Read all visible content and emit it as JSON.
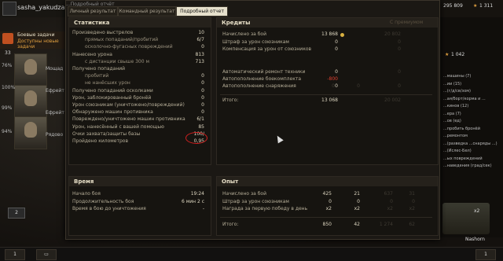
{
  "garage": {
    "username": "sasha_yakudza",
    "tasks_title": "Боевые задачи",
    "tasks_sub": "Доступны новые задачи",
    "crew_percents": [
      "100%",
      "99%",
      "94%"
    ],
    "left_badge": "33",
    "left_percent": "76%",
    "crew_names": [
      "Мощад",
      "Ефрейт",
      "Ефрейт",
      "Рядово"
    ],
    "gold": "295 809",
    "credits": "1 311",
    "right_value": "1 042",
    "tank_name": "Nashorn",
    "tank_level": "x2",
    "right_stats": [
      "...машины (7)",
      "...ии (15)",
      "...(г/д/св/зом)",
      "...ая/борт/корма и ...",
      "...кинов (12)",
      "...ера (7)",
      "...ов (ед)",
      "...пробить бронёй",
      "...ремонтом",
      "...(разведка ...снаряды ...)",
      "...(Ислес-Бел)",
      "...ых повреждений",
      "...наведения (град/сек)"
    ],
    "bottom_left": "1",
    "bottom_right": "1",
    "lock_count": "2"
  },
  "window": {
    "title": "...Подробный отчёт",
    "tabs": [
      "Личный результат",
      "Командный результат",
      "Подробный отчет"
    ],
    "active_tab": 2
  },
  "stats": {
    "header": "Статистика",
    "rows": [
      {
        "label": "Произведено выстрелов",
        "value": "10",
        "indent": false
      },
      {
        "label": "прямых попаданий/пробитий",
        "value": "6/7",
        "indent": true
      },
      {
        "label": "осколочно-фугасных повреждений",
        "value": "0",
        "indent": true
      },
      {
        "label": "Нанесено урона",
        "value": "813",
        "indent": false
      },
      {
        "label": "с дистанции свыше 300 м",
        "value": "713",
        "indent": true
      },
      {
        "label": "Получено попаданий",
        "value": "",
        "indent": false
      },
      {
        "label": "пробитий",
        "value": "0",
        "indent": true
      },
      {
        "label": "не нанёсших урон",
        "value": "0",
        "indent": true
      },
      {
        "label": "Получено попаданий осколками",
        "value": "0",
        "indent": false
      },
      {
        "label": "Урон, заблокированный бронёй",
        "value": "0",
        "indent": false
      },
      {
        "label": "Урон союзникам (уничтожено/повреждений)",
        "value": "0",
        "indent": false
      },
      {
        "label": "Обнаружено машин противника",
        "value": "0",
        "indent": false
      },
      {
        "label": "Повреждено/уничтожено машин противника",
        "value": "6/1",
        "indent": false
      },
      {
        "label": "Урон, нанесённый с вашей помощью",
        "value": "85",
        "indent": false
      },
      {
        "label": "Очки захвата/защиты базы",
        "value": "100/",
        "indent": false
      },
      {
        "label": "Пройдено километров",
        "value": "0,95",
        "indent": false
      }
    ]
  },
  "credits": {
    "header": "Кредиты",
    "premium_label": "С премиумом",
    "rows": [
      {
        "label": "Начислено за бой",
        "value": "13 868",
        "prem": "20 802",
        "icon": true
      },
      {
        "label": "Штраф за урон союзникам",
        "value": "0",
        "prem": "0",
        "icon": false
      },
      {
        "label": "Компенсация за урон от союзников",
        "value": "0",
        "prem": "0",
        "icon": false
      },
      {
        "label": "Автоматический ремонт техники",
        "value": "0",
        "prem": "0",
        "icon": false
      },
      {
        "label": "Автопополнение боекомплекта",
        "value": "-800",
        "prem": "",
        "icon": false
      },
      {
        "label": "Автопополнение снаряжения",
        "value": "0",
        "prem": "0",
        "icon": false
      }
    ],
    "total_label": "Итого:",
    "total": "13 068",
    "total_prem": "20 002",
    "extra_zeros": [
      "0",
      "0"
    ]
  },
  "time": {
    "header": "Время",
    "rows": [
      {
        "label": "Начало боя",
        "value": "19:24"
      },
      {
        "label": "Продолжительность боя",
        "value": "6 мин 2 с"
      },
      {
        "label": "Время в бою до уничтожения",
        "value": "-"
      }
    ]
  },
  "exp": {
    "header": "Опыт",
    "rows": [
      {
        "label": "Начислено за бой",
        "value": "425",
        "free": "21",
        "prem": "637",
        "pfree": "31"
      },
      {
        "label": "Штраф за урон союзникам",
        "value": "0",
        "free": "0",
        "prem": "0",
        "pfree": "0"
      },
      {
        "label": "Награда за первую победу в день",
        "value": "x2",
        "free": "x2",
        "prem": "x2",
        "pfree": "x2"
      }
    ],
    "total_label": "Итого:",
    "total": "850",
    "total_free": "42",
    "total_prem": "1 274",
    "total_pfree": "62"
  }
}
